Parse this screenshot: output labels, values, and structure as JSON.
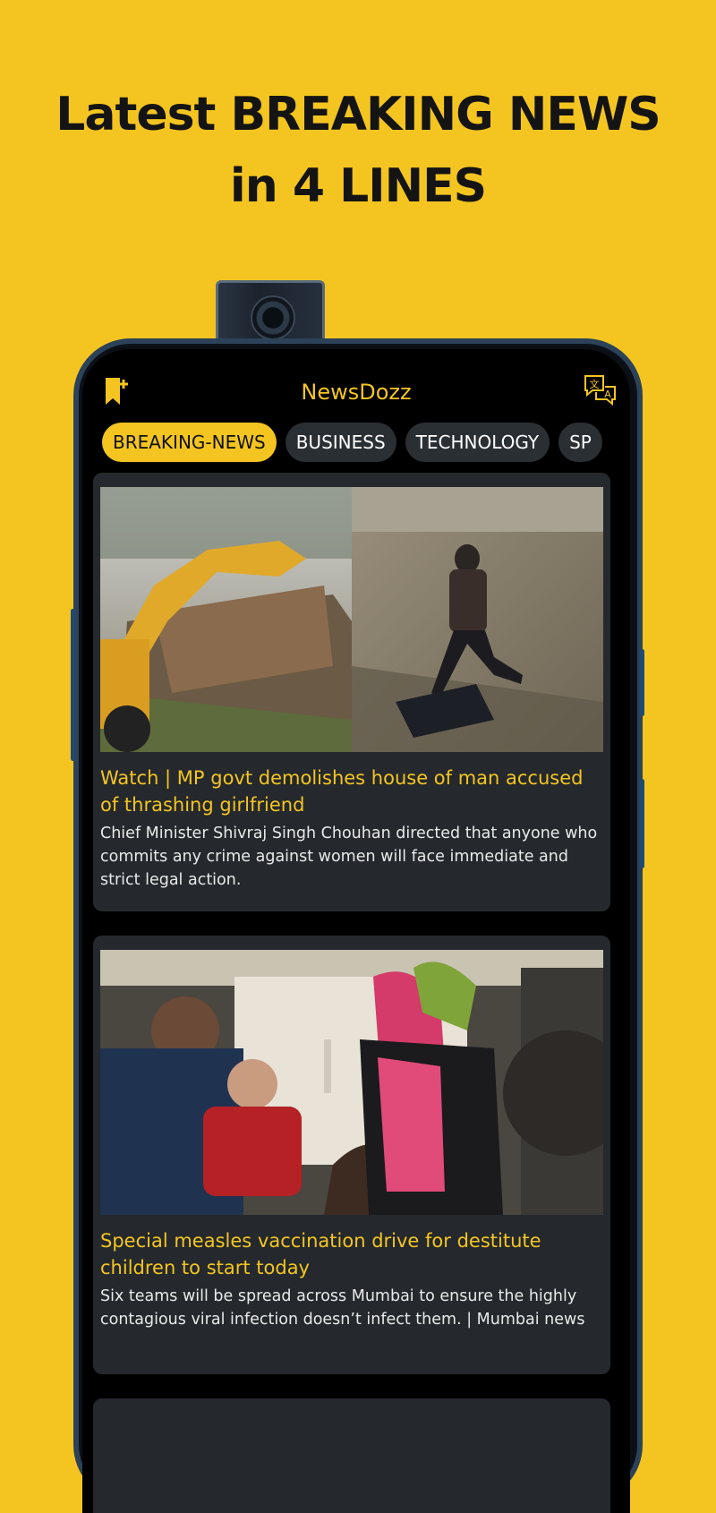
{
  "promo": {
    "line1": "Latest BREAKING NEWS",
    "line2": "in 4 LINES"
  },
  "app": {
    "title": "NewsDozz",
    "icons": {
      "left": "bookmark-plus-icon",
      "right": "translate-icon"
    }
  },
  "categories": [
    {
      "label": "BREAKING-NEWS",
      "active": true
    },
    {
      "label": "BUSINESS",
      "active": false
    },
    {
      "label": "TECHNOLOGY",
      "active": false
    },
    {
      "label": "SP",
      "active": false
    }
  ],
  "articles": [
    {
      "title": "Watch | MP govt demolishes house of man accused of thrashing girlfriend",
      "summary": "Chief Minister Shivraj Singh Chouhan directed that anyone who commits any crime against women will face immediate and strict legal action.",
      "image": "demolition-and-assault-collage"
    },
    {
      "title": "Special measles vaccination drive for destitute children to start today",
      "summary": "Six teams will be spread across Mumbai to ensure the highly contagious viral infection doesn’t infect them. | Mumbai news",
      "image": "measles-vaccination-photo"
    }
  ],
  "colors": {
    "background": "#F4C521",
    "accent": "#F4C521",
    "card": "#25292d",
    "chip": "#2a2f33"
  }
}
